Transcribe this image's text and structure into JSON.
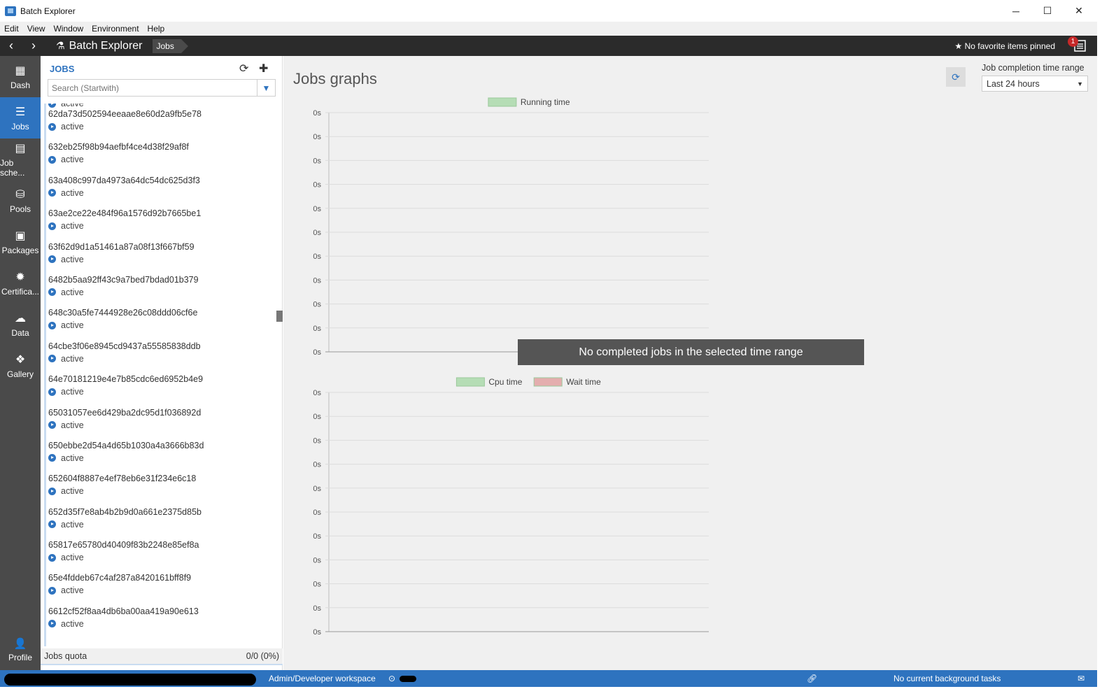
{
  "window": {
    "title": "Batch Explorer",
    "minimize": "─",
    "maximize": "☐",
    "close": "✕"
  },
  "menu": [
    "Edit",
    "View",
    "Window",
    "Environment",
    "Help"
  ],
  "header": {
    "back": "‹",
    "forward": "›",
    "brand": "Batch Explorer",
    "breadcrumb": "Jobs",
    "favorites": "No favorite items pinned",
    "notification_count": "1"
  },
  "sidebar": {
    "items": [
      {
        "label": "Dash",
        "icon": "▦"
      },
      {
        "label": "Jobs",
        "icon": "☰"
      },
      {
        "label": "Job sche...",
        "icon": "▤"
      },
      {
        "label": "Pools",
        "icon": "⛁"
      },
      {
        "label": "Packages",
        "icon": "▣"
      },
      {
        "label": "Certifica...",
        "icon": "✹"
      },
      {
        "label": "Data",
        "icon": "☁"
      },
      {
        "label": "Gallery",
        "icon": "❖"
      }
    ],
    "profile": {
      "label": "Profile",
      "icon": "👤"
    }
  },
  "jobs_panel": {
    "title": "JOBS",
    "search_placeholder": "Search (Startwith)",
    "partial_state": "active",
    "items": [
      {
        "id": "62da73d502594eeaae8e60d2a9fb5e78",
        "state": "active"
      },
      {
        "id": "632eb25f98b94aefbf4ce4d38f29af8f",
        "state": "active"
      },
      {
        "id": "63a408c997da4973a64dc54dc625d3f3",
        "state": "active"
      },
      {
        "id": "63ae2ce22e484f96a1576d92b7665be1",
        "state": "active"
      },
      {
        "id": "63f62d9d1a51461a87a08f13f667bf59",
        "state": "active"
      },
      {
        "id": "6482b5aa92ff43c9a7bed7bdad01b379",
        "state": "active"
      },
      {
        "id": "648c30a5fe7444928e26c08ddd06cf6e",
        "state": "active"
      },
      {
        "id": "64cbe3f06e8945cd9437a55585838ddb",
        "state": "active"
      },
      {
        "id": "64e70181219e4e7b85cdc6ed6952b4e9",
        "state": "active"
      },
      {
        "id": "65031057ee6d429ba2dc95d1f036892d",
        "state": "active"
      },
      {
        "id": "650ebbe2d54a4d65b1030a4a3666b83d",
        "state": "active"
      },
      {
        "id": "652604f8887e4ef78eb6e31f234e6c18",
        "state": "active"
      },
      {
        "id": "652d35f7e8ab4b2b9d0a661e2375d85b",
        "state": "active"
      },
      {
        "id": "65817e65780d40409f83b2248e85ef8a",
        "state": "active"
      },
      {
        "id": "65e4fddeb67c4af287a8420161bff8f9",
        "state": "active"
      },
      {
        "id": "6612cf52f8aa4db6ba00aa419a90e613",
        "state": "active"
      }
    ],
    "quota_label": "Jobs quota",
    "quota_value": "0/0 (0%)"
  },
  "main": {
    "heading": "Jobs graphs",
    "range_label": "Job completion time range",
    "range_selected": "Last 24 hours",
    "overlay": "No completed jobs in the selected time range"
  },
  "chart_data": [
    {
      "type": "bar",
      "title": "",
      "series": [
        {
          "name": "Running time",
          "color": "#b5ddb5",
          "values": []
        }
      ],
      "y_ticks": [
        "0s",
        "0s",
        "0s",
        "0s",
        "0s",
        "0s",
        "0s",
        "0s",
        "0s",
        "0s",
        "0s"
      ],
      "grid": true,
      "legend": "top-center"
    },
    {
      "type": "bar",
      "title": "",
      "series": [
        {
          "name": "Cpu time",
          "color": "#b5ddb5",
          "values": []
        },
        {
          "name": "Wait time",
          "color": "#e4aeae",
          "values": []
        }
      ],
      "y_ticks": [
        "0s",
        "0s",
        "0s",
        "0s",
        "0s",
        "0s",
        "0s",
        "0s",
        "0s",
        "0s",
        "0s"
      ],
      "grid": true,
      "legend": "top-center"
    }
  ],
  "statusbar": {
    "workspace": "Admin/Developer workspace",
    "background_tasks": "No current background tasks"
  },
  "colors": {
    "accent": "#2e73bf",
    "sidebar": "#4a4a4a",
    "header": "#2b2b2b"
  }
}
